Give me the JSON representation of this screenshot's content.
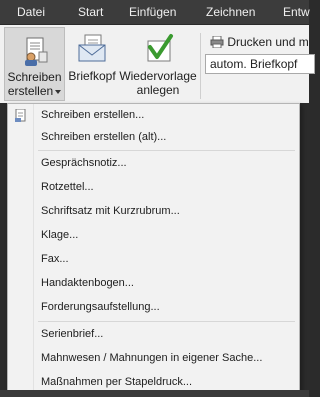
{
  "tabs": [
    "Datei",
    "Start",
    "Einfügen",
    "Zeichnen",
    "Entw"
  ],
  "ribbon": {
    "schreiben": {
      "line1": "Schreiben",
      "line2": "erstellen"
    },
    "briefkopf": "Briefkopf",
    "wiedervorlage": {
      "line1": "Wiedervorlage",
      "line2": "anlegen"
    },
    "print_label": "Drucken und m",
    "briefkopf_select": "autom. Briefkopf"
  },
  "menu": {
    "items": [
      "Schreiben erstellen...",
      "Schreiben erstellen (alt)...",
      "Gesprächsnotiz...",
      "Rotzettel...",
      "Schriftsatz mit Kurzrubrum...",
      "Klage...",
      "Fax...",
      "Handaktenbogen...",
      "Forderungsaufstellung...",
      "Serienbrief...",
      "Mahnwesen / Mahnungen in eigener Sache...",
      "Maßnahmen per Stapeldruck..."
    ]
  },
  "colors": {
    "tabbar": "#3c3c3c",
    "ribbon": "#f1f1f1",
    "menu": "#f2f2f2",
    "accent_green": "#3a9a2f"
  },
  "icons": [
    "document-user-icon",
    "envelope-icon",
    "checkmark-document-icon",
    "printer-icon",
    "small-document-icon"
  ]
}
